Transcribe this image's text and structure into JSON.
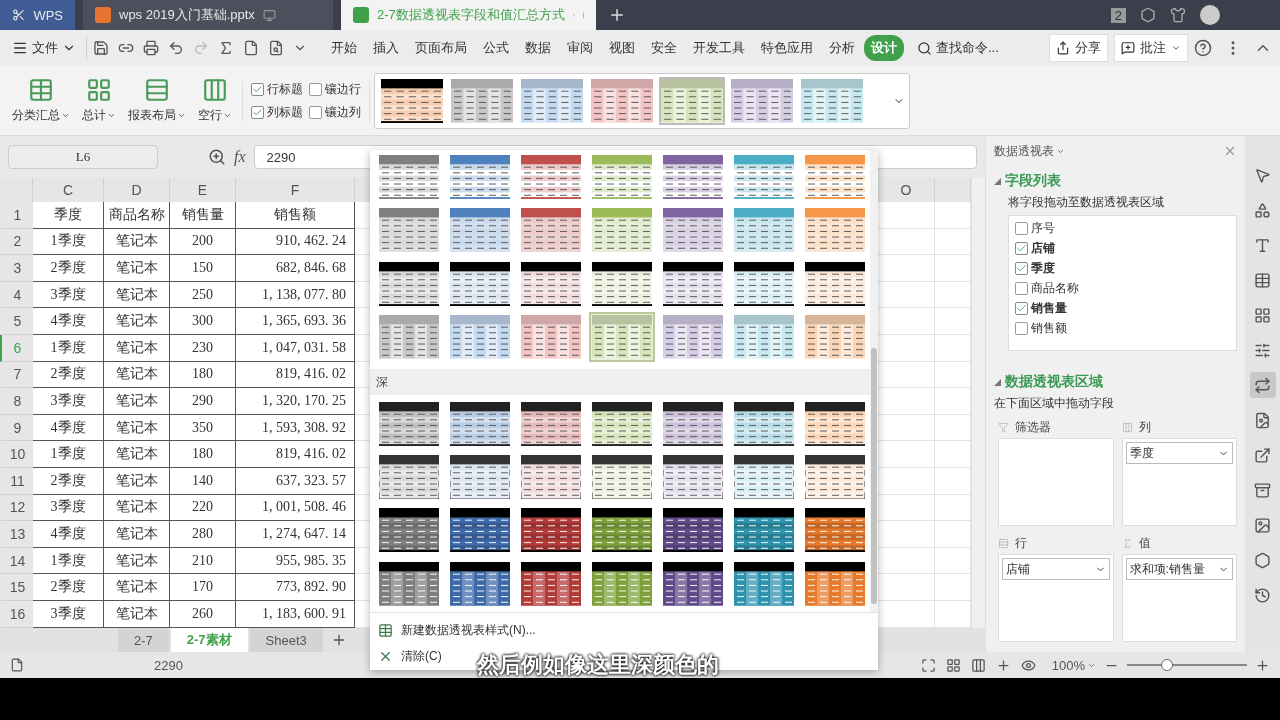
{
  "title_bar": {
    "tabs": [
      {
        "kind": "home",
        "label": "WPS",
        "selected": false
      },
      {
        "kind": "presentation",
        "label": "wps 2019入门基础.pptx",
        "selected": false
      },
      {
        "kind": "spreadsheet",
        "label": "2-7数据透视表字段和值汇总方式",
        "selected": true
      }
    ],
    "badge": "2"
  },
  "menu": {
    "file": "文件",
    "items": [
      {
        "label": "开始",
        "selected": false
      },
      {
        "label": "插入",
        "selected": false
      },
      {
        "label": "页面布局",
        "selected": false
      },
      {
        "label": "公式",
        "selected": false
      },
      {
        "label": "数据",
        "selected": false
      },
      {
        "label": "审阅",
        "selected": false
      },
      {
        "label": "视图",
        "selected": false
      },
      {
        "label": "安全",
        "selected": false
      },
      {
        "label": "开发工具",
        "selected": false
      },
      {
        "label": "特色应用",
        "selected": false
      },
      {
        "label": "分析",
        "selected": false
      },
      {
        "label": "设计",
        "selected": true
      }
    ],
    "search": "查找命令...",
    "share": "分享",
    "comment": "批注"
  },
  "ribbon": {
    "buttons": [
      {
        "kind": "subtotal",
        "label": "分类汇总"
      },
      {
        "kind": "total",
        "label": "总计"
      },
      {
        "kind": "layout",
        "label": "报表布局"
      },
      {
        "kind": "blank",
        "label": "空行"
      }
    ],
    "options": [
      {
        "label": "行标题",
        "checked": true
      },
      {
        "label": "镶边行",
        "checked": false
      },
      {
        "label": "列标题",
        "checked": true
      },
      {
        "label": "镶边列",
        "checked": false
      }
    ],
    "styles": [
      {
        "kind": "black-header",
        "color": "#f8cbad",
        "selected": false
      },
      {
        "kind": "column-bands",
        "color": "#c8c8c8",
        "selected": false
      },
      {
        "kind": "column-bands",
        "color": "#c5d9f1",
        "selected": false
      },
      {
        "kind": "column-bands",
        "color": "#f2c4c3",
        "selected": false
      },
      {
        "kind": "column-bands",
        "color": "#d8e4bc",
        "selected": true
      },
      {
        "kind": "column-bands",
        "color": "#d6cde6",
        "selected": false
      },
      {
        "kind": "column-bands",
        "color": "#c6e8f0",
        "selected": false
      }
    ]
  },
  "formula_bar": {
    "cell": "L6",
    "fx": "fx",
    "value": "2290"
  },
  "sheet": {
    "columns": [
      "C",
      "D",
      "E",
      "F"
    ],
    "far_column": "O",
    "rows": [
      {
        "number": "1",
        "selected": false,
        "cells": [
          "季度",
          "商品名称",
          "销售量",
          "销售额"
        ]
      },
      {
        "number": "2",
        "selected": false,
        "cells": [
          "1季度",
          "笔记本",
          "200",
          "910, 462. 24"
        ]
      },
      {
        "number": "3",
        "selected": false,
        "cells": [
          "2季度",
          "笔记本",
          "150",
          "682, 846. 68"
        ]
      },
      {
        "number": "4",
        "selected": false,
        "cells": [
          "3季度",
          "笔记本",
          "250",
          "1, 138, 077. 80"
        ]
      },
      {
        "number": "5",
        "selected": false,
        "cells": [
          "4季度",
          "笔记本",
          "300",
          "1, 365, 693. 36"
        ]
      },
      {
        "number": "6",
        "selected": true,
        "cells": [
          "1季度",
          "笔记本",
          "230",
          "1, 047, 031. 58"
        ]
      },
      {
        "number": "7",
        "selected": false,
        "cells": [
          "2季度",
          "笔记本",
          "180",
          "819, 416. 02"
        ]
      },
      {
        "number": "8",
        "selected": false,
        "cells": [
          "3季度",
          "笔记本",
          "290",
          "1, 320, 170. 25"
        ]
      },
      {
        "number": "9",
        "selected": false,
        "cells": [
          "4季度",
          "笔记本",
          "350",
          "1, 593, 308. 92"
        ]
      },
      {
        "number": "10",
        "selected": false,
        "cells": [
          "1季度",
          "笔记本",
          "180",
          "819, 416. 02"
        ]
      },
      {
        "number": "11",
        "selected": false,
        "cells": [
          "2季度",
          "笔记本",
          "140",
          "637, 323. 57"
        ]
      },
      {
        "number": "12",
        "selected": false,
        "cells": [
          "3季度",
          "笔记本",
          "220",
          "1, 001, 508. 46"
        ]
      },
      {
        "number": "13",
        "selected": false,
        "cells": [
          "4季度",
          "笔记本",
          "280",
          "1, 274, 647. 14"
        ]
      },
      {
        "number": "14",
        "selected": false,
        "cells": [
          "1季度",
          "笔记本",
          "210",
          "955, 985. 35"
        ]
      },
      {
        "number": "15",
        "selected": false,
        "cells": [
          "2季度",
          "笔记本",
          "170",
          "773, 892. 90"
        ]
      },
      {
        "number": "16",
        "selected": false,
        "cells": [
          "3季度",
          "笔记本",
          "260",
          "1, 183, 600. 91"
        ]
      }
    ]
  },
  "sheet_tabs": [
    {
      "label": "2-7",
      "selected": false
    },
    {
      "label": "2-7素材",
      "selected": true
    },
    {
      "label": "Sheet3",
      "selected": false
    }
  ],
  "style_gallery": {
    "sections": [
      {
        "rows": [
          {
            "kind": "header-lines",
            "styles": [
              {
                "color": "#7f7f7f",
                "selected": false
              },
              {
                "color": "#4f81bd",
                "selected": false
              },
              {
                "color": "#c0504d",
                "selected": false
              },
              {
                "color": "#9bbb59",
                "selected": false
              },
              {
                "color": "#8064a2",
                "selected": false
              },
              {
                "color": "#4bacc6",
                "selected": false
              },
              {
                "color": "#f79646",
                "selected": false
              }
            ]
          },
          {
            "kind": "header-bands",
            "styles": [
              {
                "color": "#7f7f7f",
                "selected": false
              },
              {
                "color": "#4f81bd",
                "selected": false
              },
              {
                "color": "#c0504d",
                "selected": false
              },
              {
                "color": "#9bbb59",
                "selected": false
              },
              {
                "color": "#8064a2",
                "selected": false
              },
              {
                "color": "#4bacc6",
                "selected": false
              },
              {
                "color": "#f79646",
                "selected": false
              }
            ]
          },
          {
            "kind": "black-header",
            "styles": [
              {
                "color": "#d9d9d9",
                "selected": false
              },
              {
                "color": "#dbe5f1",
                "selected": false
              },
              {
                "color": "#f2dcdb",
                "selected": false
              },
              {
                "color": "#ebf1de",
                "selected": false
              },
              {
                "color": "#e4dfec",
                "selected": false
              },
              {
                "color": "#daeef3",
                "selected": false
              },
              {
                "color": "#fde9d9",
                "selected": false
              }
            ]
          },
          {
            "kind": "column-bands",
            "styles": [
              {
                "color": "#c8c8c8",
                "selected": false
              },
              {
                "color": "#c5d9f1",
                "selected": false
              },
              {
                "color": "#f2c4c3",
                "selected": false
              },
              {
                "color": "#d8e4bc",
                "selected": true
              },
              {
                "color": "#d6cde6",
                "selected": false
              },
              {
                "color": "#c6e8f0",
                "selected": false
              },
              {
                "color": "#fcd5b4",
                "selected": false
              }
            ]
          }
        ]
      },
      {
        "label": "深",
        "rows": [
          {
            "kind": "medium",
            "styles": [
              {
                "color": "#bfbfbf",
                "selected": false
              },
              {
                "color": "#b8cce4",
                "selected": false
              },
              {
                "color": "#e6b8b7",
                "selected": false
              },
              {
                "color": "#d7e4bc",
                "selected": false
              },
              {
                "color": "#ccc0da",
                "selected": false
              },
              {
                "color": "#b7dee8",
                "selected": false
              },
              {
                "color": "#fcd5b4",
                "selected": false
              }
            ]
          },
          {
            "kind": "bordered",
            "styles": [
              {
                "color": "#d9d9d9",
                "selected": false
              },
              {
                "color": "#dbe5f1",
                "selected": false
              },
              {
                "color": "#f2dcdb",
                "selected": false
              },
              {
                "color": "#ebf1de",
                "selected": false
              },
              {
                "color": "#e4dfec",
                "selected": false
              },
              {
                "color": "#daeef3",
                "selected": false
              },
              {
                "color": "#fde9d9",
                "selected": false
              }
            ]
          },
          {
            "kind": "dark",
            "styles": [
              {
                "color": "#7f7f7f",
                "selected": false
              },
              {
                "color": "#3f6aa8",
                "selected": false
              },
              {
                "color": "#b23b38",
                "selected": false
              },
              {
                "color": "#7ea13e",
                "selected": false
              },
              {
                "color": "#614a8a",
                "selected": false
              },
              {
                "color": "#2f93ad",
                "selected": false
              },
              {
                "color": "#e8792a",
                "selected": false
              }
            ]
          },
          {
            "kind": "dark-columns",
            "styles": [
              {
                "color": "#7f7f7f",
                "selected": false
              },
              {
                "color": "#3f6aa8",
                "selected": false
              },
              {
                "color": "#b23b38",
                "selected": false
              },
              {
                "color": "#7ea13e",
                "selected": false
              },
              {
                "color": "#614a8a",
                "selected": false
              },
              {
                "color": "#2f93ad",
                "selected": false
              },
              {
                "color": "#e8792a",
                "selected": false
              }
            ]
          }
        ]
      }
    ],
    "actions": [
      {
        "kind": "new",
        "label": "新建数据透视表样式(N)..."
      },
      {
        "kind": "clear",
        "label": "清除(C)"
      }
    ]
  },
  "pivot_panel": {
    "title": "数据透视表",
    "field_section": "字段列表",
    "field_hint": "将字段拖动至数据透视表区域",
    "fields": [
      {
        "label": "序号",
        "checked": false
      },
      {
        "label": "店铺",
        "checked": true
      },
      {
        "label": "季度",
        "checked": true
      },
      {
        "label": "商品名称",
        "checked": false
      },
      {
        "label": "销售量",
        "checked": true
      },
      {
        "label": "销售额",
        "checked": false
      }
    ],
    "area_section": "数据透视表区域",
    "area_hint": "在下面区域中拖动字段",
    "zones": [
      {
        "kind": "filter",
        "label": "筛选器"
      },
      {
        "kind": "columns",
        "label": "列",
        "fields": [
          "季度"
        ]
      },
      {
        "kind": "rows",
        "label": "行",
        "fields": [
          "店铺"
        ]
      },
      {
        "kind": "values",
        "label": "值",
        "fields": [
          "求和项:销售量"
        ]
      }
    ]
  },
  "side_tools": [
    {
      "kind": "pointer",
      "selected": false
    },
    {
      "kind": "shapes",
      "selected": false
    },
    {
      "kind": "style",
      "selected": false
    },
    {
      "kind": "table",
      "selected": false
    },
    {
      "kind": "grid",
      "selected": false
    },
    {
      "kind": "sliders",
      "selected": false
    },
    {
      "kind": "pivot",
      "selected": true
    },
    {
      "kind": "picture-doc",
      "selected": false
    },
    {
      "kind": "share",
      "selected": false
    },
    {
      "kind": "archive",
      "selected": false
    },
    {
      "kind": "image",
      "selected": false
    },
    {
      "kind": "badge",
      "selected": false
    },
    {
      "kind": "history",
      "selected": false
    }
  ],
  "status_bar": {
    "value": "2290",
    "zoom": "100%",
    "zoom_slider": {
      "level": 0.33
    }
  },
  "caption": "然后例如像这里深颜色的"
}
